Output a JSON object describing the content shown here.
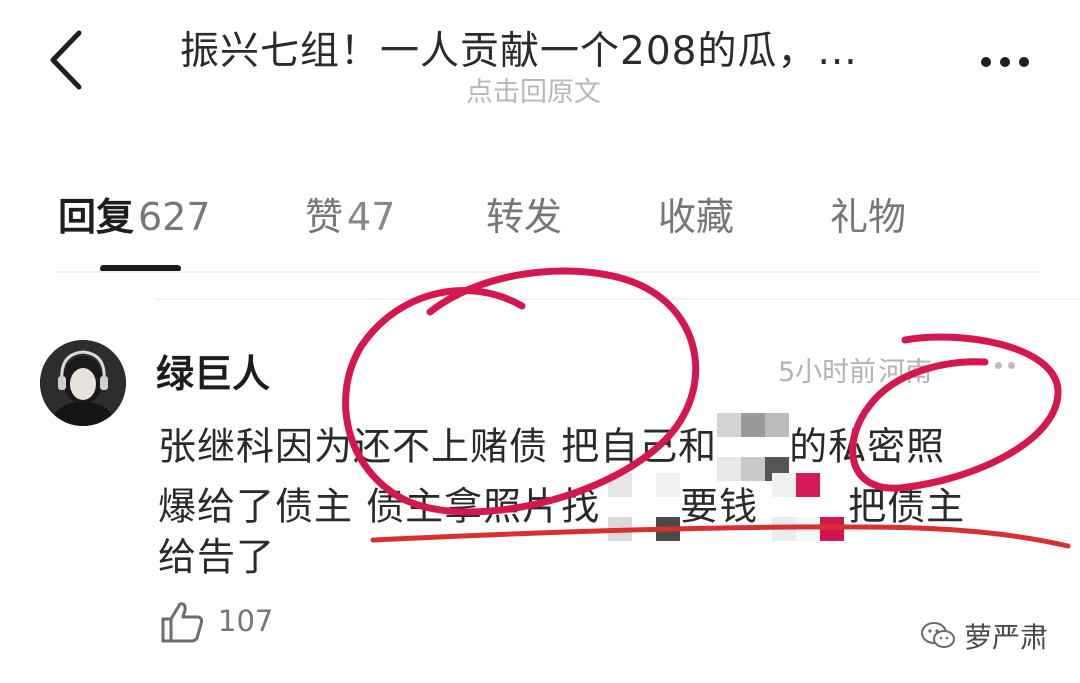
{
  "header": {
    "back_icon": "chevron-left-icon",
    "title": "振兴七组！一人贡献一个208的瓜，...",
    "subtitle": "点击回原文",
    "more_icon": "more-horizontal-icon"
  },
  "tabs": [
    {
      "label": "回复",
      "count": "627",
      "active": true
    },
    {
      "label": "赞",
      "count": "47",
      "active": false
    },
    {
      "label": "转发",
      "count": "",
      "active": false
    },
    {
      "label": "收藏",
      "count": "",
      "active": false
    },
    {
      "label": "礼物",
      "count": "",
      "active": false
    }
  ],
  "comment": {
    "username": "绿巨人",
    "time": "5小时前",
    "location": "河南",
    "line1_a": "张继科因为还不上赌债 把自己和",
    "line1_b": "的私密照",
    "line2_a": "爆给了债主 债主拿照片找",
    "line2_b": "要钱",
    "line2_c": "把债主",
    "line3": "给告了",
    "like_count": "107"
  },
  "watermark": {
    "text": "萝严肃",
    "icon": "wechat-icon"
  },
  "colors": {
    "annotation_red": "#d4184f",
    "underline_red": "#d8302f"
  }
}
